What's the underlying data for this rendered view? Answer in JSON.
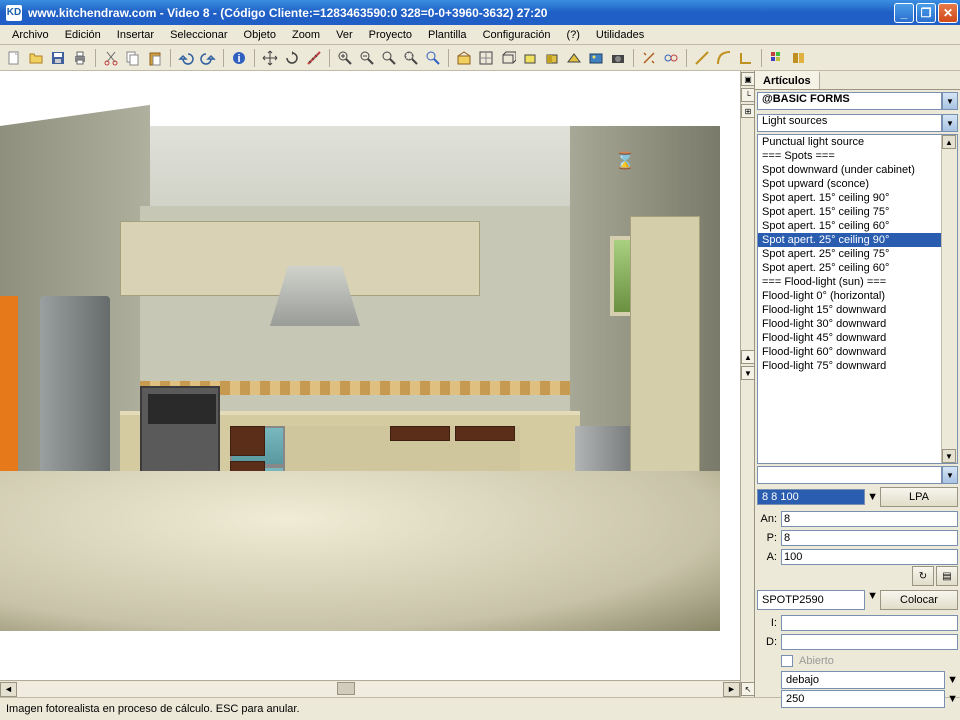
{
  "titlebar": {
    "logo": "KD",
    "title": "www.kitchendraw.com - Video 8 - (Código Cliente:=1283463590:0 328=0-0+3960-3632) 27:20"
  },
  "menu": [
    "Archivo",
    "Edición",
    "Insertar",
    "Seleccionar",
    "Objeto",
    "Zoom",
    "Ver",
    "Proyecto",
    "Plantilla",
    "Configuración",
    "(?)",
    "Utilidades"
  ],
  "sidepanel": {
    "tab": "Artículos",
    "catalog": "@BASIC FORMS",
    "category": "Light sources",
    "items": [
      "Punctual light source",
      "=== Spots ===",
      "Spot downward (under cabinet)",
      "Spot upward (sconce)",
      "Spot apert. 15° ceiling 90°",
      "Spot apert. 15° ceiling 75°",
      "Spot apert. 15° ceiling 60°",
      "Spot apert. 25° ceiling 90°",
      "Spot apert. 25° ceiling 75°",
      "Spot apert. 25° ceiling 60°",
      "=== Flood-light (sun) ===",
      "Flood-light 0° (horizontal)",
      "Flood-light 15° downward",
      "Flood-light 30° downward",
      "Flood-light 45° downward",
      "Flood-light 60° downward",
      "Flood-light 75° downward"
    ],
    "selected_index": 7,
    "size_summary": "8   8 100",
    "lpa": "LPA",
    "an_label": "An:",
    "an_val": "8",
    "p_label": "P:",
    "p_val": "8",
    "a_label": "A:",
    "a_val": "100",
    "ref": "SPOTP2590",
    "colocar": "Colocar",
    "i_label": "I:",
    "i_val": "",
    "d_label": "D:",
    "d_val": "",
    "abierto": "Abierto",
    "pos1": "debajo",
    "pos2": "250"
  },
  "statusbar": {
    "msg": "Imagen fotorealista en proceso de cálculo. ESC para anular."
  },
  "hourglass": "⌛"
}
